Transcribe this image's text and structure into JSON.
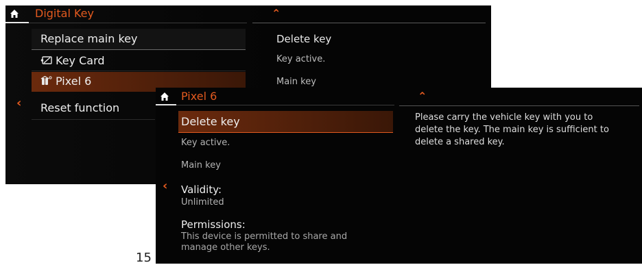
{
  "back_screen": {
    "header_title": "Digital Key",
    "menu": {
      "replace_main_key": "Replace main key",
      "key_card": "Key Card",
      "pixel_6": "Pixel 6",
      "reset_function": "Reset function"
    },
    "right_panel": {
      "title": "Delete key",
      "status": "Key active.",
      "role": "Main key"
    }
  },
  "front_screen": {
    "header_title": "Pixel 6",
    "menu": {
      "delete_key": "Delete key",
      "key_active": "Key active.",
      "main_key": "Main key",
      "validity_label": "Validity:",
      "validity_value": "Unlimited",
      "permissions_label": "Permissions:",
      "permissions_line1": "This device is permitted to share and",
      "permissions_line2": "manage other keys."
    },
    "description": [
      "Please carry the vehicle key with you to",
      "delete the key. The main key is sufficient to",
      "delete a shared key."
    ]
  },
  "page_number": "15",
  "icons": {
    "home": "home-icon",
    "scroll_up": "chevron-up-icon",
    "back": "chevron-left-icon",
    "key_card": "key-card-icon",
    "phone_key": "phone-key-icon"
  },
  "colors": {
    "accent": "#e35a1f",
    "background": "#050505",
    "highlight": "#6b2a0d"
  }
}
